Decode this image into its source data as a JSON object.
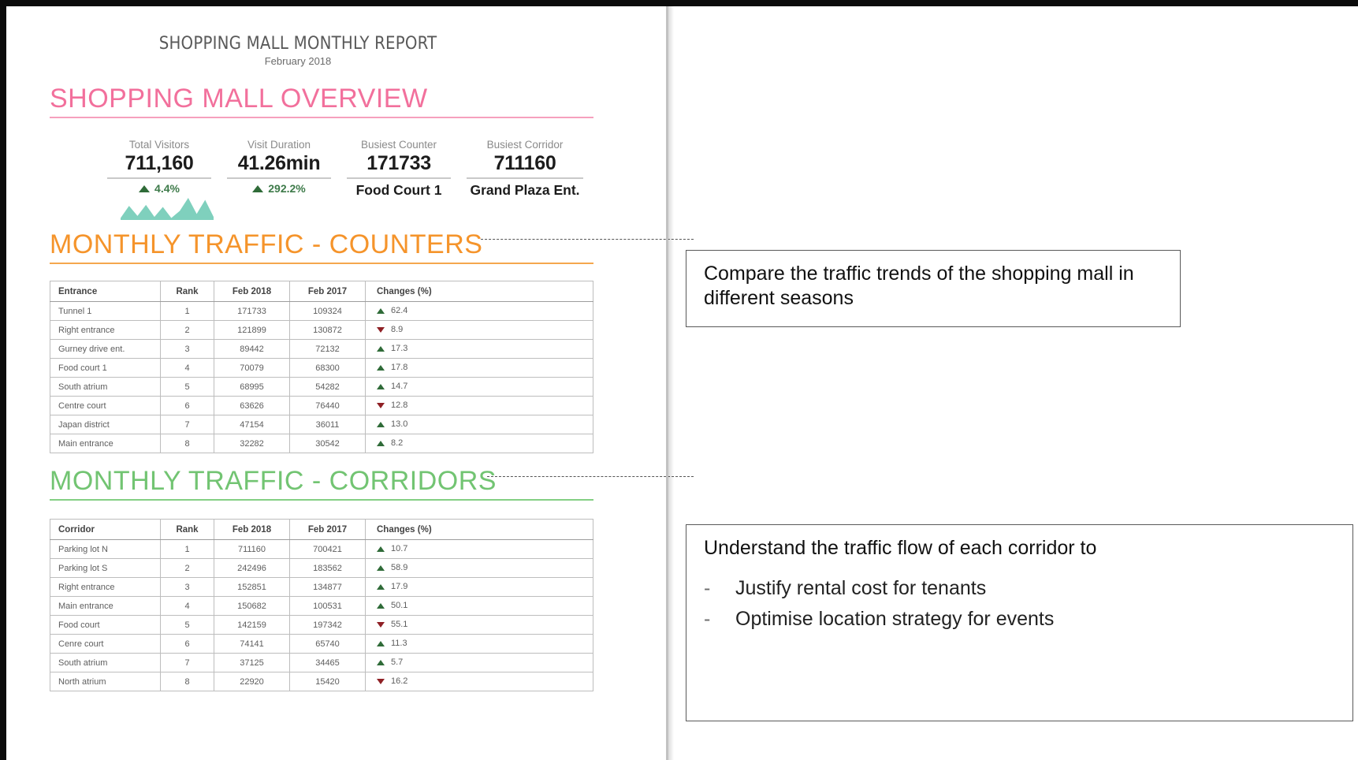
{
  "report": {
    "title": "SHOPPING MALL MONTHLY REPORT",
    "subtitle": "February 2018",
    "sections": {
      "overview": {
        "title": "SHOPPING MALL OVERVIEW",
        "color": "#f2709c"
      },
      "counters": {
        "title": "MONTHLY TRAFFIC - COUNTERS",
        "color": "#f5942b"
      },
      "corridors": {
        "title": "MONTHLY TRAFFIC - CORRIDORS",
        "color": "#72c472"
      }
    },
    "kpis": [
      {
        "label": "Total Visitors",
        "value": "711,160",
        "delta": "4.4%",
        "direction": "up",
        "sub": ""
      },
      {
        "label": "Visit Duration",
        "value": "41.26min",
        "delta": "292.2%",
        "direction": "up",
        "sub": ""
      },
      {
        "label": "Busiest Counter",
        "value": "171733",
        "delta": "",
        "direction": "",
        "sub": "Food Court 1"
      },
      {
        "label": "Busiest Corridor",
        "value": "711160",
        "delta": "",
        "direction": "",
        "sub": "Grand Plaza Ent."
      }
    ],
    "sparkline": {
      "color": "#7fd0bd",
      "values": [
        2,
        14,
        4,
        15,
        3,
        13,
        2,
        9,
        22,
        6,
        20,
        3
      ]
    },
    "counters_table": {
      "headers": [
        "Entrance",
        "Rank",
        "Feb 2018",
        "Feb 2017",
        "Changes (%)"
      ],
      "rows": [
        {
          "name": "Tunnel 1",
          "rank": "1",
          "feb2018": "171733",
          "feb2017": "109324",
          "change": "62.4",
          "direction": "up"
        },
        {
          "name": "Right entrance",
          "rank": "2",
          "feb2018": "121899",
          "feb2017": "130872",
          "change": "8.9",
          "direction": "down"
        },
        {
          "name": "Gurney drive ent.",
          "rank": "3",
          "feb2018": "89442",
          "feb2017": "72132",
          "change": "17.3",
          "direction": "up"
        },
        {
          "name": "Food court 1",
          "rank": "4",
          "feb2018": "70079",
          "feb2017": "68300",
          "change": "17.8",
          "direction": "up"
        },
        {
          "name": "South atrium",
          "rank": "5",
          "feb2018": "68995",
          "feb2017": "54282",
          "change": "14.7",
          "direction": "up"
        },
        {
          "name": "Centre court",
          "rank": "6",
          "feb2018": "63626",
          "feb2017": "76440",
          "change": "12.8",
          "direction": "down"
        },
        {
          "name": "Japan district",
          "rank": "7",
          "feb2018": "47154",
          "feb2017": "36011",
          "change": "13.0",
          "direction": "up"
        },
        {
          "name": "Main entrance",
          "rank": "8",
          "feb2018": "32282",
          "feb2017": "30542",
          "change": "8.2",
          "direction": "up"
        }
      ]
    },
    "corridors_table": {
      "headers": [
        "Corridor",
        "Rank",
        "Feb 2018",
        "Feb 2017",
        "Changes (%)"
      ],
      "rows": [
        {
          "name": "Parking lot N",
          "rank": "1",
          "feb2018": "711160",
          "feb2017": "700421",
          "change": "10.7",
          "direction": "up"
        },
        {
          "name": "Parking lot S",
          "rank": "2",
          "feb2018": "242496",
          "feb2017": "183562",
          "change": "58.9",
          "direction": "up"
        },
        {
          "name": "Right entrance",
          "rank": "3",
          "feb2018": "152851",
          "feb2017": "134877",
          "change": "17.9",
          "direction": "up"
        },
        {
          "name": "Main entrance",
          "rank": "4",
          "feb2018": "150682",
          "feb2017": "100531",
          "change": "50.1",
          "direction": "up"
        },
        {
          "name": "Food court",
          "rank": "5",
          "feb2018": "142159",
          "feb2017": "197342",
          "change": "55.1",
          "direction": "down"
        },
        {
          "name": "Cenre court",
          "rank": "6",
          "feb2018": "74141",
          "feb2017": "65740",
          "change": "11.3",
          "direction": "up"
        },
        {
          "name": "South atrium",
          "rank": "7",
          "feb2018": "37125",
          "feb2017": "34465",
          "change": "5.7",
          "direction": "up"
        },
        {
          "name": "North atrium",
          "rank": "8",
          "feb2018": "22920",
          "feb2017": "15420",
          "change": "16.2",
          "direction": "down"
        }
      ]
    }
  },
  "annotations": {
    "counters_callout": {
      "text": "Compare the traffic trends of the shopping mall in different seasons"
    },
    "corridors_callout": {
      "heading": "Understand the traffic flow of each corridor to",
      "dash": "-",
      "items": [
        "Justify rental cost for tenants",
        "Optimise location strategy for events"
      ]
    }
  }
}
